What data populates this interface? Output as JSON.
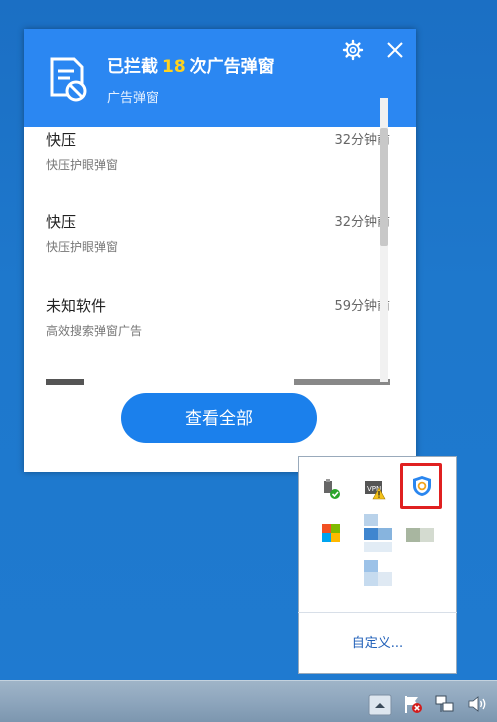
{
  "popup": {
    "title_prefix": "已拦截",
    "blocked_count": "18",
    "title_suffix": "次广告弹窗",
    "subtitle": "广告弹窗",
    "view_all_label": "查看全部",
    "items": [
      {
        "app": "快压",
        "desc": "快压护眼弹窗",
        "time": "32分钟前"
      },
      {
        "app": "快压",
        "desc": "快压护眼弹窗",
        "time": "32分钟前"
      },
      {
        "app": "未知软件",
        "desc": "高效搜索弹窗广告",
        "time": "59分钟前"
      }
    ]
  },
  "tray": {
    "customize_label": "自定义...",
    "icons": [
      "usb-safe-remove-icon",
      "vpn-warning-icon",
      "ad-block-shield-icon",
      "colorful-app-icon",
      "blurred-app-icon",
      "blurred-app-icon-2",
      "blurred-app-icon-3"
    ]
  },
  "taskbar": {
    "icons": [
      "show-hidden-icons-icon",
      "action-center-flag-icon",
      "network-icon",
      "volume-icon"
    ]
  },
  "colors": {
    "header_blue": "#2b87f2",
    "count_yellow": "#ffd21e",
    "button_blue": "#1b80ec",
    "highlight_red": "#e02020"
  }
}
